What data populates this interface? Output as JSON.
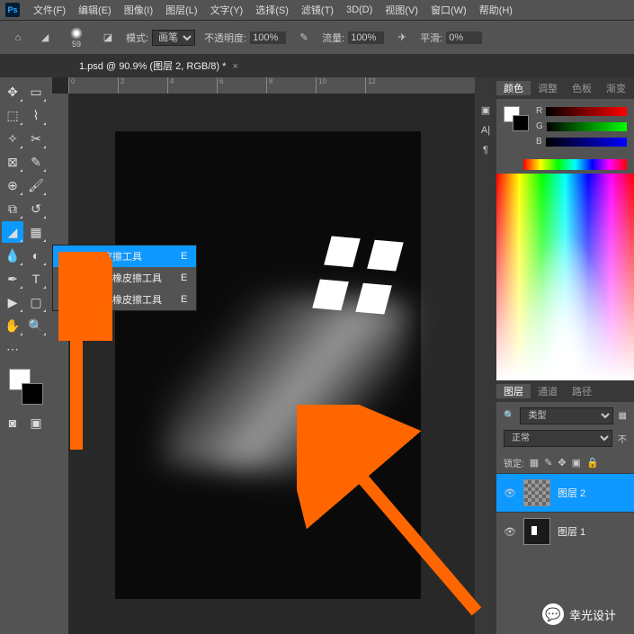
{
  "app": {
    "logo": "Ps"
  },
  "menu": [
    "文件(F)",
    "编辑(E)",
    "图像(I)",
    "图层(L)",
    "文字(Y)",
    "选择(S)",
    "滤镜(T)",
    "3D(D)",
    "视图(V)",
    "窗口(W)",
    "帮助(H)"
  ],
  "options": {
    "brush_size": "59",
    "mode_label": "模式:",
    "mode_value": "画笔",
    "opacity_label": "不透明度:",
    "opacity_value": "100%",
    "flow_label": "流量:",
    "flow_value": "100%",
    "smooth_label": "平滑:",
    "smooth_value": "0%"
  },
  "tab": {
    "title": "1.psd @ 90.9% (图层 2, RGB/8) *"
  },
  "ruler_marks": [
    "0",
    "2",
    "4",
    "6",
    "8",
    "10",
    "12"
  ],
  "flyout": {
    "items": [
      {
        "label": "橡皮擦工具",
        "key": "E",
        "selected": true
      },
      {
        "label": "背景橡皮擦工具",
        "key": "E",
        "selected": false
      },
      {
        "label": "魔术橡皮擦工具",
        "key": "E",
        "selected": false
      }
    ]
  },
  "prop_icons": [
    "▣",
    "A|",
    "¶"
  ],
  "color_panel": {
    "tabs": [
      "颜色",
      "调整",
      "色板",
      "渐变"
    ],
    "channels": [
      "R",
      "G",
      "B"
    ]
  },
  "layers_panel": {
    "tabs": [
      "图层",
      "通道",
      "路径"
    ],
    "kind_label": "类型",
    "blend_mode": "正常",
    "lock_label": "锁定:",
    "layers": [
      {
        "name": "图层 2",
        "selected": true,
        "thumb": "checker"
      },
      {
        "name": "图层 1",
        "selected": false,
        "thumb": "win"
      }
    ]
  },
  "watermark": "幸光设计",
  "search_icon": "🔍"
}
